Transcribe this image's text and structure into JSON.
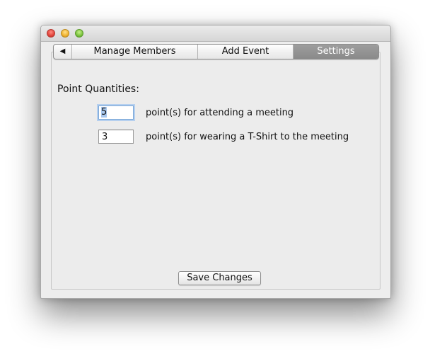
{
  "window": {
    "title": ""
  },
  "tabs": {
    "back_arrow": "◀",
    "items": [
      {
        "label": "Manage Members"
      },
      {
        "label": "Add Event"
      },
      {
        "label": "Settings"
      }
    ],
    "selected": "Settings"
  },
  "settings": {
    "section_label": "Point Quantities:",
    "rows": [
      {
        "value": "5",
        "label": "point(s) for attending a meeting"
      },
      {
        "value": "3",
        "label": "point(s) for wearing a T-Shirt to the meeting"
      }
    ]
  },
  "actions": {
    "save_label": "Save Changes"
  },
  "colors": {
    "selected_tab": "#8f8f8f",
    "focus_ring": "#a9c8ee"
  }
}
